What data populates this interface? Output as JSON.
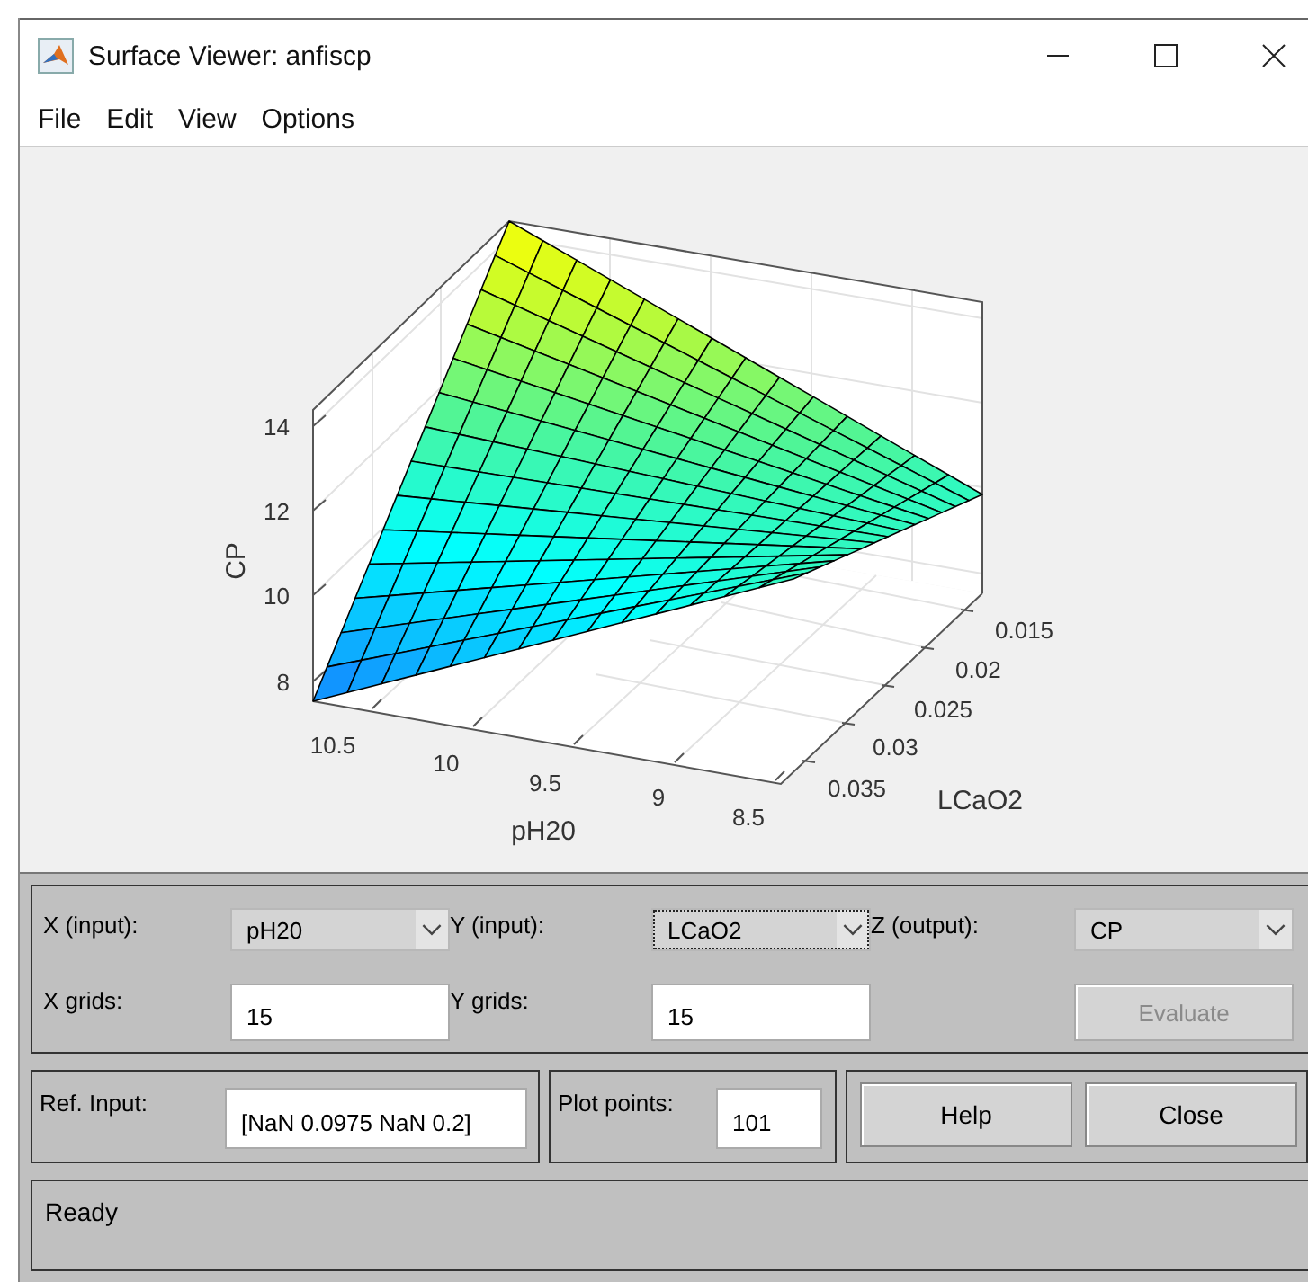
{
  "window": {
    "title": "Surface Viewer: anfiscp"
  },
  "menu": [
    "File",
    "Edit",
    "View",
    "Options"
  ],
  "plot": {
    "z_axis": {
      "label": "CP",
      "ticks": [
        "14",
        "12",
        "10",
        "8"
      ]
    },
    "x_axis": {
      "label": "pH20",
      "ticks": [
        "10.5",
        "10",
        "9.5",
        "9",
        "8.5"
      ]
    },
    "y_axis": {
      "label": "LCaO2",
      "ticks": [
        "0.015",
        "0.02",
        "0.025",
        "0.03",
        "0.035"
      ]
    }
  },
  "selectors": [
    {
      "label": "X (input):",
      "value": "pH20",
      "focused": false
    },
    {
      "label": "Y (input):",
      "value": "LCaO2",
      "focused": true
    },
    {
      "label": "Z (output):",
      "value": "CP",
      "focused": false
    }
  ],
  "grids": [
    {
      "label": "X grids:",
      "value": "15"
    },
    {
      "label": "Y grids:",
      "value": "15"
    }
  ],
  "evaluate_button": {
    "label": "Evaluate",
    "disabled": true
  },
  "ref_input": {
    "label": "Ref. Input:",
    "value": "[NaN 0.0975 NaN 0.2]"
  },
  "plot_points": {
    "label": "Plot points:",
    "value": "101"
  },
  "buttons": [
    "Help",
    "Close"
  ],
  "status": "Ready"
}
